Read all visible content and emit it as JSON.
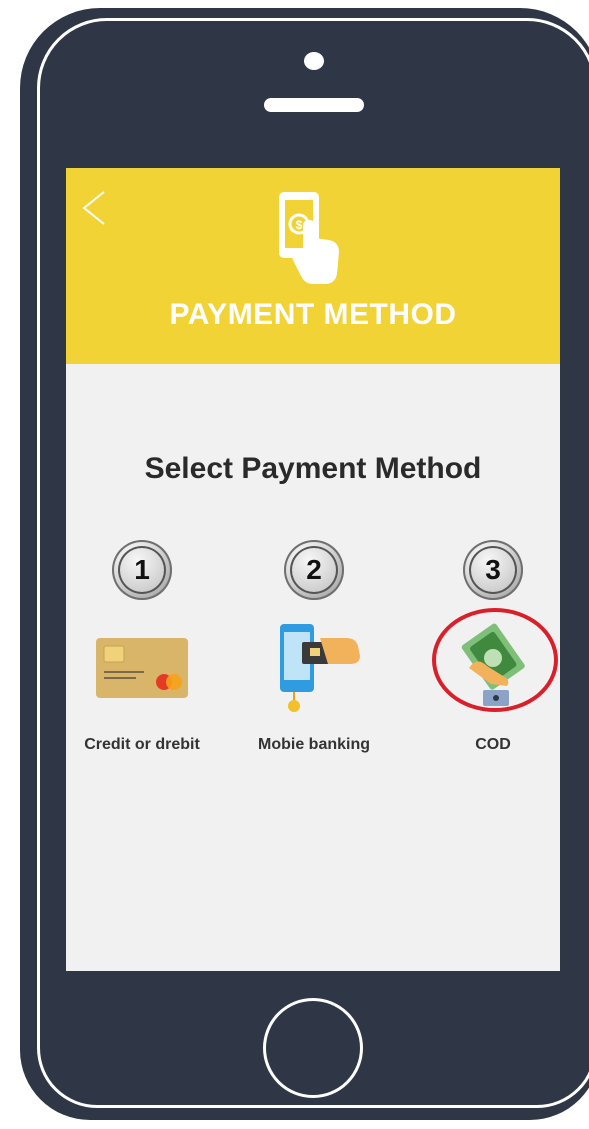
{
  "header": {
    "title": "PAYMENT METHOD",
    "back_icon": "chevron-left-icon",
    "icon": "mobile-payment-icon"
  },
  "main": {
    "title": "Select Payment Method",
    "options": [
      {
        "number": "1",
        "label": "Credit or drebit",
        "icon": "credit-card-icon"
      },
      {
        "number": "2",
        "label": "Mobie banking",
        "icon": "mobile-banking-icon"
      },
      {
        "number": "3",
        "label": "COD",
        "icon": "cash-on-delivery-icon",
        "highlighted": true
      }
    ]
  },
  "colors": {
    "header_bg": "#f2d335",
    "screen_bg": "#f1f1f1",
    "phone_body": "#2f3747",
    "highlight": "#d9202a"
  }
}
